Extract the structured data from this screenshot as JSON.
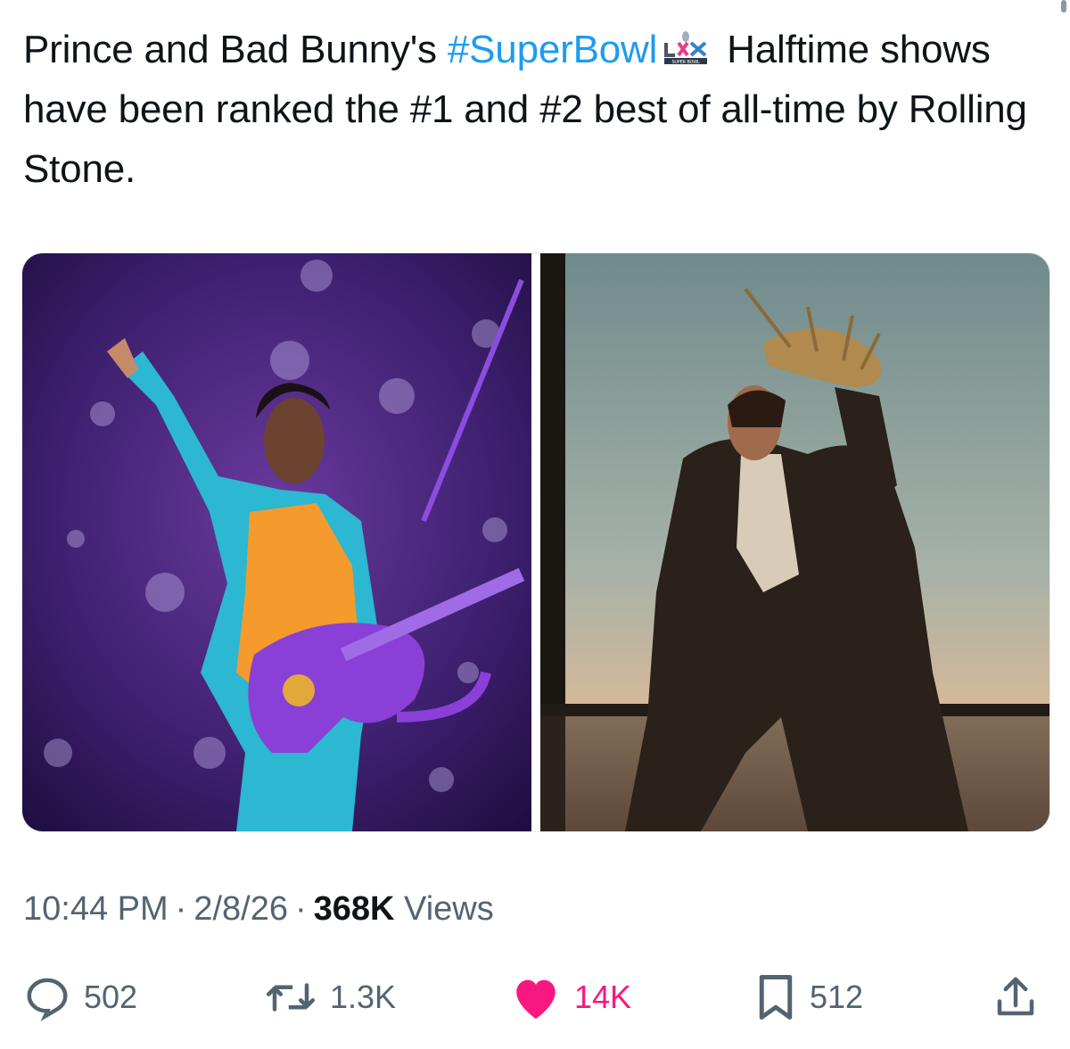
{
  "tweet": {
    "text_before": "Prince and Bad Bunny's ",
    "hashtag": "#SuperBowl",
    "text_after": " Halftime shows have been ranked the #1 and #2 best of all-time by Rolling Stone.",
    "hashtag_emoji": "super-bowl-lx-emoji",
    "emoji_text": "SUPER BOWL"
  },
  "media": {
    "left_photo": "prince-performing-photo",
    "right_photo": "bad-bunny-straw-hat-photo"
  },
  "meta": {
    "time": "10:44 PM",
    "separator": "·",
    "date": "2/8/26",
    "views_count": "368K",
    "views_label": "Views"
  },
  "actions": {
    "replies": "502",
    "reposts": "1.3K",
    "likes": "14K",
    "bookmarks": "512",
    "reply_icon": "reply-icon",
    "repost_icon": "repost-icon",
    "like_icon": "heart-icon",
    "bookmark_icon": "bookmark-icon",
    "share_icon": "share-icon"
  },
  "colors": {
    "text": "#0f1419",
    "secondary": "#536471",
    "link": "#1d9bf0",
    "like": "#f91880"
  }
}
